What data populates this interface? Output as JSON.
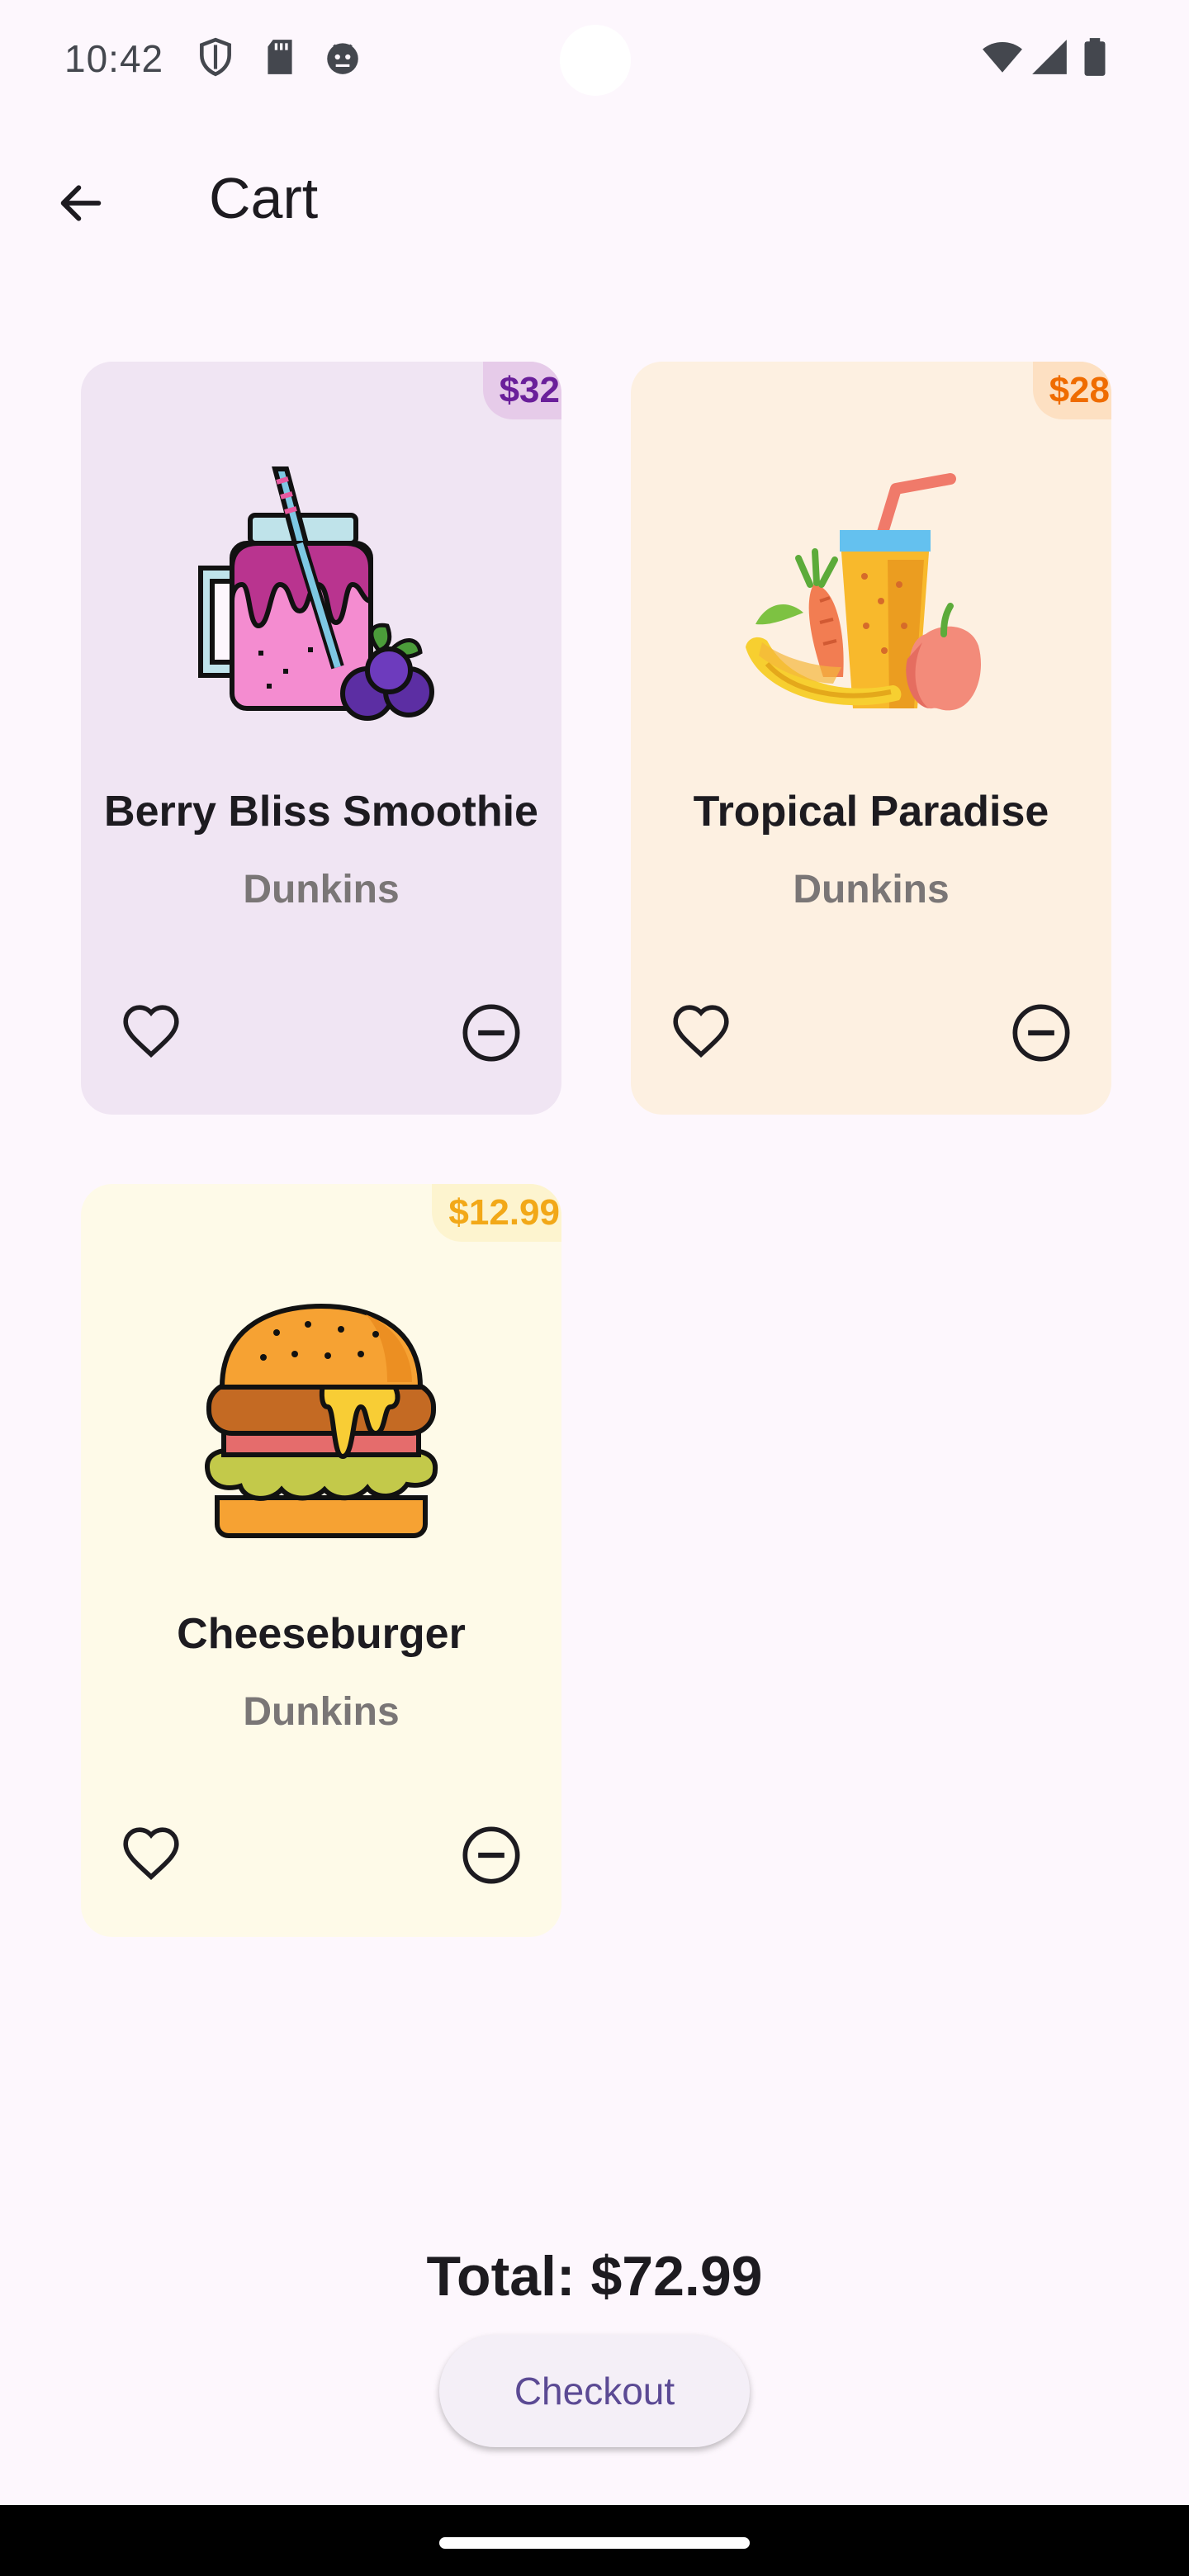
{
  "status_bar": {
    "time": "10:42",
    "left_icons": [
      "shield-icon",
      "sd-card-icon",
      "android-debug-icon"
    ],
    "right_icons": [
      "wifi-icon",
      "signal-icon",
      "battery-icon"
    ]
  },
  "app_bar": {
    "back_icon": "arrow-back-icon",
    "title": "Cart"
  },
  "cart": {
    "items": [
      {
        "name": "Berry Bliss Smoothie",
        "shop": "Dunkins",
        "price": "$32",
        "image": "berry-smoothie-icon",
        "card_color": "#f0e5f3",
        "badge_color": "#e6cbe9",
        "price_color": "#6a1f9a"
      },
      {
        "name": "Tropical Paradise",
        "shop": "Dunkins",
        "price": "$28",
        "image": "tropical-juice-icon",
        "card_color": "#fdf0e1",
        "badge_color": "#fde0c2",
        "price_color": "#ef6c00"
      },
      {
        "name": "Cheeseburger",
        "shop": "Dunkins",
        "price": "$12.99",
        "image": "cheeseburger-icon",
        "card_color": "#fefae8",
        "badge_color": "#fdf4cf",
        "price_color": "#f2a818"
      }
    ]
  },
  "footer": {
    "total": "Total: $72.99",
    "checkout_label": "Checkout"
  },
  "colors": {
    "background": "#fdf7fd",
    "checkout_text": "#5b4a94"
  }
}
